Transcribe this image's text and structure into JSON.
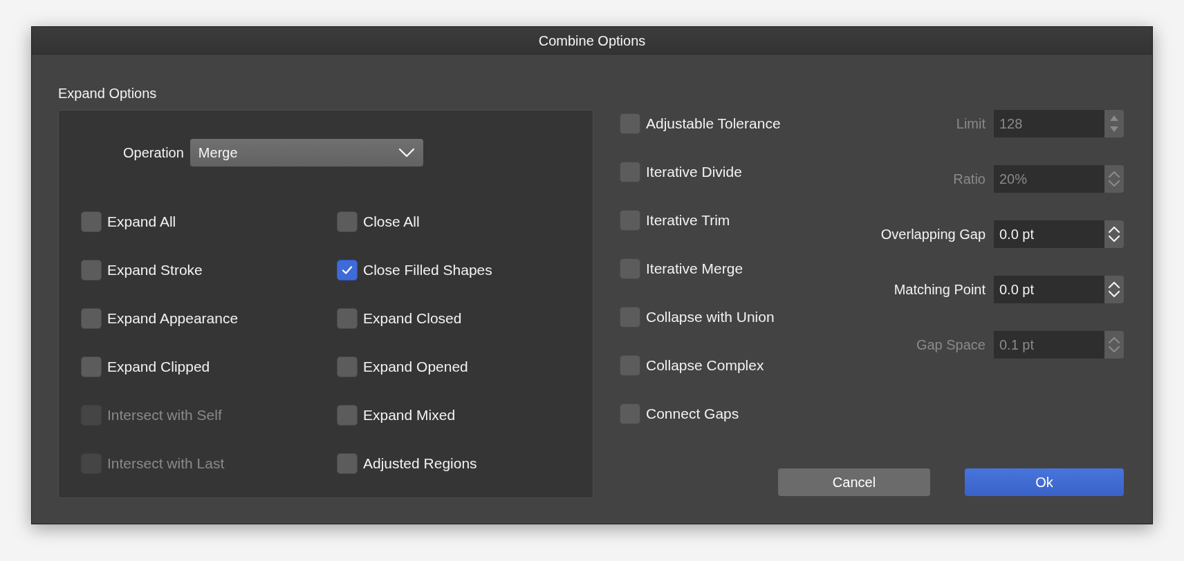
{
  "window": {
    "title": "Combine Options"
  },
  "expand_options": {
    "title": "Expand Options",
    "operation": {
      "label": "Operation",
      "value": "Merge"
    },
    "columns": [
      [
        {
          "label": "Expand All",
          "checked": false,
          "disabled": false
        },
        {
          "label": "Expand Stroke",
          "checked": false,
          "disabled": false
        },
        {
          "label": "Expand Appearance",
          "checked": false,
          "disabled": false
        },
        {
          "label": "Expand Clipped",
          "checked": false,
          "disabled": false
        },
        {
          "label": "Intersect with Self",
          "checked": false,
          "disabled": true
        },
        {
          "label": "Intersect with Last",
          "checked": false,
          "disabled": true
        }
      ],
      [
        {
          "label": "Close All",
          "checked": false,
          "disabled": false
        },
        {
          "label": "Close Filled Shapes",
          "checked": true,
          "disabled": false
        },
        {
          "label": "Expand Closed",
          "checked": false,
          "disabled": false
        },
        {
          "label": "Expand Opened",
          "checked": false,
          "disabled": false
        },
        {
          "label": "Expand Mixed",
          "checked": false,
          "disabled": false
        },
        {
          "label": "Adjusted Regions",
          "checked": false,
          "disabled": false
        }
      ]
    ]
  },
  "options": [
    {
      "label": "Adjustable Tolerance",
      "checked": false,
      "disabled": false
    },
    {
      "label": "Iterative Divide",
      "checked": false,
      "disabled": false
    },
    {
      "label": "Iterative Trim",
      "checked": false,
      "disabled": false
    },
    {
      "label": "Iterative Merge",
      "checked": false,
      "disabled": false
    },
    {
      "label": "Collapse with Union",
      "checked": false,
      "disabled": false
    },
    {
      "label": "Collapse Complex",
      "checked": false,
      "disabled": false
    },
    {
      "label": "Connect Gaps",
      "checked": false,
      "disabled": false
    }
  ],
  "fields": [
    {
      "label": "Limit",
      "value": "128",
      "disabled": true,
      "kind": "arrows"
    },
    {
      "label": "Ratio",
      "value": "20%",
      "disabled": true,
      "kind": "chevrons"
    },
    {
      "label": "Overlapping Gap",
      "value": "0.0 pt",
      "disabled": false,
      "kind": "chevrons"
    },
    {
      "label": "Matching Point",
      "value": "0.0 pt",
      "disabled": false,
      "kind": "chevrons"
    },
    {
      "label": "Gap Space",
      "value": "0.1 pt",
      "disabled": true,
      "kind": "chevrons"
    }
  ],
  "buttons": [
    {
      "label": "Cancel",
      "kind": "secondary"
    },
    {
      "label": "Ok",
      "kind": "primary"
    }
  ]
}
